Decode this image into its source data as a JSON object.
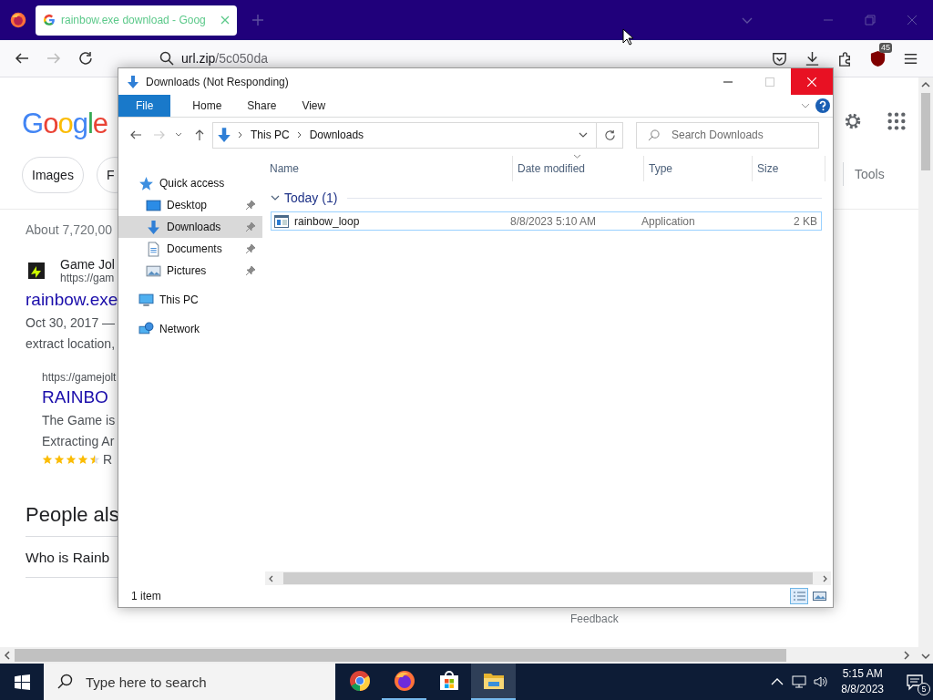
{
  "browser": {
    "tabs": [
      {
        "title": "rainbow.exe download - Goog",
        "selected": true
      }
    ],
    "url_host": "url.zip",
    "url_path": "/5c050da",
    "extension_badge": "45"
  },
  "google": {
    "logo": "Google",
    "chips": [
      "Images",
      "F"
    ],
    "tools": "Tools",
    "result_stats": "About 7,720,00",
    "result": {
      "site": "Game Jol",
      "url": "https://gam",
      "title": "rainbow.exe",
      "snippet": [
        "Oct 30, 2017 —",
        "extract location,"
      ]
    },
    "sub_result": {
      "url": "https://gamejolt",
      "title": "RAINBO",
      "snippet": [
        "The Game is",
        "Extracting Ar"
      ],
      "stars": 4.5,
      "rating": "R"
    },
    "people_also_ask": {
      "heading": "People als",
      "questions": [
        "Who is Rainb"
      ]
    },
    "feedback": "Feedback"
  },
  "explorer": {
    "title": "Downloads (Not Responding)",
    "ribbon_tabs": [
      {
        "label": "File",
        "selected": true
      },
      {
        "label": "Home",
        "selected": false
      },
      {
        "label": "Share",
        "selected": false
      },
      {
        "label": "View",
        "selected": false
      }
    ],
    "breadcrumb": [
      "This PC",
      "Downloads"
    ],
    "search": {
      "placeholder": "Search Downloads"
    },
    "nav": [
      {
        "label": "Quick access",
        "kind": "quick-access",
        "selected": false,
        "children": [
          {
            "label": "Desktop",
            "kind": "desktop",
            "selected": false,
            "pinned": true
          },
          {
            "label": "Downloads",
            "kind": "downloads",
            "selected": true,
            "pinned": true
          },
          {
            "label": "Documents",
            "kind": "documents",
            "selected": false,
            "pinned": true
          },
          {
            "label": "Pictures",
            "kind": "pictures",
            "selected": false,
            "pinned": true
          }
        ]
      },
      {
        "label": "This PC",
        "kind": "pc",
        "selected": false
      },
      {
        "label": "Network",
        "kind": "network",
        "selected": false
      }
    ],
    "columns": [
      {
        "label": "Name",
        "sorted": false
      },
      {
        "label": "Date modified",
        "sorted": true
      },
      {
        "label": "Type",
        "sorted": false
      },
      {
        "label": "Size",
        "sorted": false
      }
    ],
    "groups": [
      {
        "label": "Today (1)",
        "expanded": true,
        "files": [
          {
            "name": "rainbow_loop",
            "date": "8/8/2023 5:10 AM",
            "type": "Application",
            "size": "2 KB",
            "focused": true
          }
        ]
      }
    ],
    "status": "1 item",
    "views": [
      {
        "kind": "details",
        "selected": true
      },
      {
        "kind": "large-icons",
        "selected": false
      }
    ]
  },
  "taskbar": {
    "search_placeholder": "Type here to search",
    "apps": [
      {
        "kind": "chrome",
        "running": false,
        "active": false
      },
      {
        "kind": "firefox",
        "running": true,
        "active": false
      },
      {
        "kind": "store",
        "running": false,
        "active": false
      },
      {
        "kind": "explorer",
        "running": true,
        "active": true
      }
    ],
    "time": "5:15 AM",
    "date": "8/8/2023",
    "notifications": "5"
  }
}
